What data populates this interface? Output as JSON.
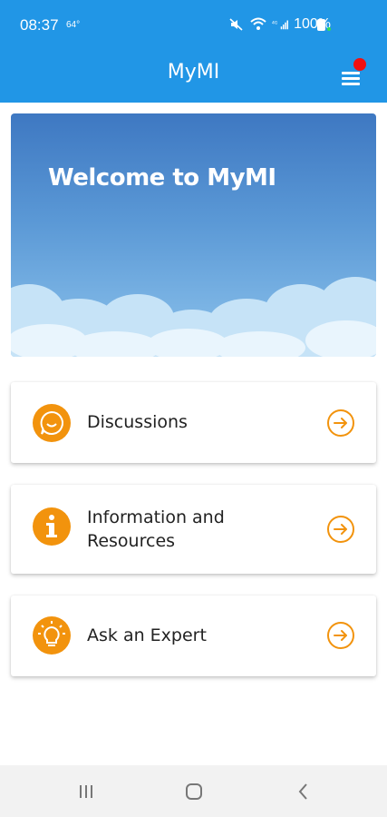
{
  "status_bar": {
    "time": "08:37",
    "temp": "64°",
    "battery": "100%"
  },
  "app_bar": {
    "title": "MyMI",
    "color": "#2196e6",
    "notification_dot_color": "#f01010"
  },
  "hero": {
    "title": "Welcome to MyMI"
  },
  "cards": [
    {
      "label": "Discussions",
      "icon": "chat-bubble-icon"
    },
    {
      "label_line1": "Information and",
      "label_line2": "Resources",
      "icon": "info-icon"
    },
    {
      "label": "Ask an Expert",
      "icon": "lightbulb-icon"
    }
  ],
  "accent_color": "#f2930d",
  "nav_bar": {
    "items": [
      "recents-icon",
      "home-icon",
      "back-icon"
    ]
  }
}
